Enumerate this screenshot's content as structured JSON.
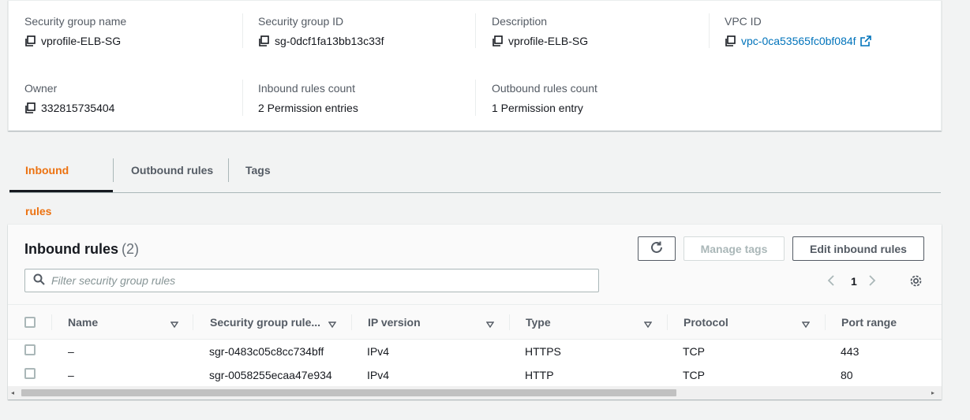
{
  "details": {
    "sg_name": {
      "label": "Security group name",
      "value": "vprofile-ELB-SG"
    },
    "sg_id": {
      "label": "Security group ID",
      "value": "sg-0dcf1fa13bb13c33f"
    },
    "description": {
      "label": "Description",
      "value": "vprofile-ELB-SG"
    },
    "vpc_id": {
      "label": "VPC ID",
      "value": "vpc-0ca53565fc0bf084f"
    },
    "owner": {
      "label": "Owner",
      "value": "332815735404"
    },
    "inbound_count": {
      "label": "Inbound rules count",
      "value": "2 Permission entries"
    },
    "outbound_count": {
      "label": "Outbound rules count",
      "value": "1 Permission entry"
    }
  },
  "tabs": [
    {
      "label": "Inbound rules",
      "active": true
    },
    {
      "label": "Outbound rules",
      "active": false
    },
    {
      "label": "Tags",
      "active": false
    }
  ],
  "rules_panel": {
    "title": "Inbound rules",
    "count": "(2)",
    "manage_tags_label": "Manage tags",
    "edit_label": "Edit inbound rules",
    "search_placeholder": "Filter security group rules",
    "page": "1",
    "columns": [
      "Name",
      "Security group rule...",
      "IP version",
      "Type",
      "Protocol",
      "Port range"
    ],
    "rows": [
      {
        "name": "–",
        "rule_id": "sgr-0483c05c8cc734bff",
        "ip_version": "IPv4",
        "type": "HTTPS",
        "protocol": "TCP",
        "port_range": "443"
      },
      {
        "name": "–",
        "rule_id": "sgr-0058255ecaa47e934",
        "ip_version": "IPv4",
        "type": "HTTP",
        "protocol": "TCP",
        "port_range": "80"
      }
    ]
  },
  "icons": {
    "copy": "copy-icon",
    "external": "external-link-icon",
    "refresh": "refresh-icon",
    "search": "search-icon",
    "settings": "gear-icon"
  },
  "colors": {
    "accent_orange": "#ec7211",
    "link_blue": "#0073bb",
    "background": "#f2f3f3"
  }
}
